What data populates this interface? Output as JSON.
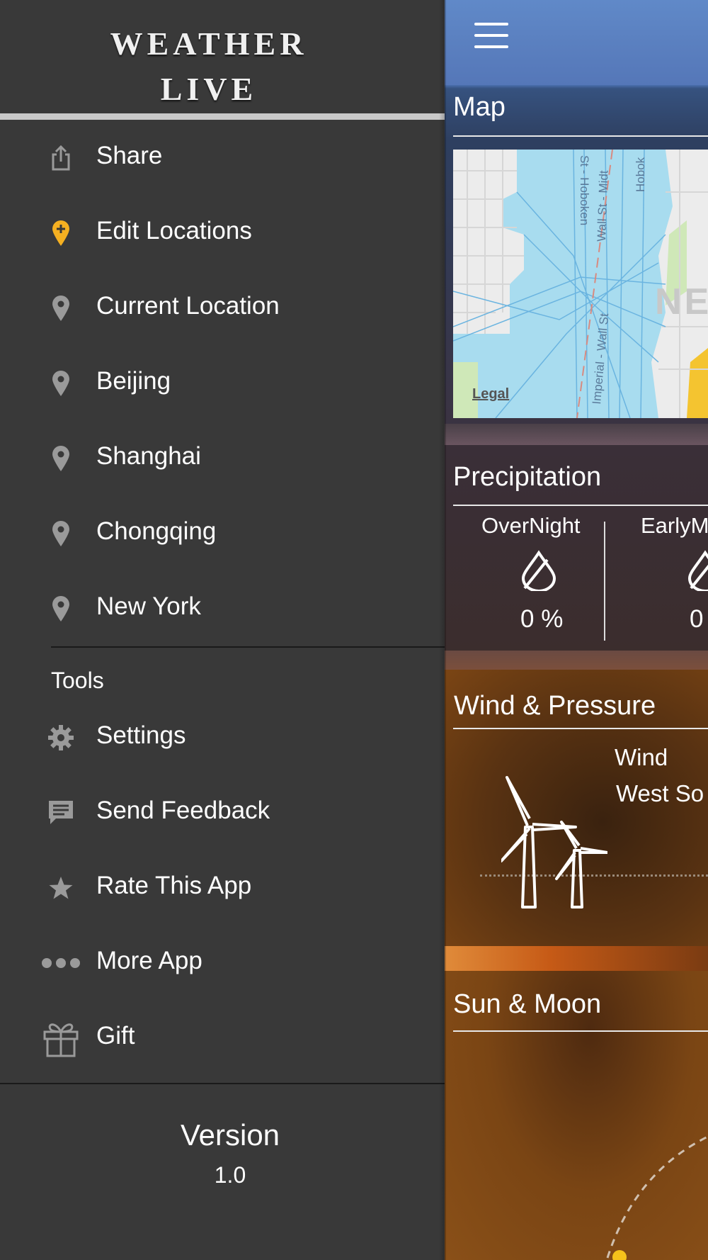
{
  "app": {
    "logo_line1": "WEATHER",
    "logo_line2": "LIVE",
    "accent_color": "#f5b021",
    "icon_gray": "#9a9a9a"
  },
  "menu": {
    "items": [
      {
        "label": "Share",
        "icon": "share-icon"
      },
      {
        "label": "Edit Locations",
        "icon": "add-location-pin-icon"
      },
      {
        "label": "Current Location",
        "icon": "location-pin-icon"
      },
      {
        "label": "Beijing",
        "icon": "location-pin-icon"
      },
      {
        "label": "Shanghai",
        "icon": "location-pin-icon"
      },
      {
        "label": "Chongqing",
        "icon": "location-pin-icon"
      },
      {
        "label": "New York",
        "icon": "location-pin-icon"
      }
    ],
    "tools_heading": "Tools",
    "tools": [
      {
        "label": "Settings",
        "icon": "gear-icon"
      },
      {
        "label": "Send Feedback",
        "icon": "chat-bubble-icon"
      },
      {
        "label": "Rate This App",
        "icon": "star-icon"
      },
      {
        "label": "More App",
        "icon": "dots-icon"
      },
      {
        "label": "Gift",
        "icon": "gift-icon"
      }
    ],
    "version_label": "Version",
    "version_number": "1.0"
  },
  "content": {
    "map_title": "Map",
    "map_legal": "Legal",
    "map_label_partial": "NE",
    "map_streets": [
      "St - Hoboken",
      "Wall St - Midt",
      "Hobok",
      "Imperial - Wall St"
    ],
    "precip_title": "Precipitation",
    "precip_periods": [
      {
        "label": "OverNight",
        "value": "0 %"
      },
      {
        "label": "EarlyM",
        "value": "0"
      }
    ],
    "wind_title": "Wind & Pressure",
    "wind_label": "Wind",
    "wind_direction": "West So",
    "sun_title": "Sun & Moon"
  }
}
